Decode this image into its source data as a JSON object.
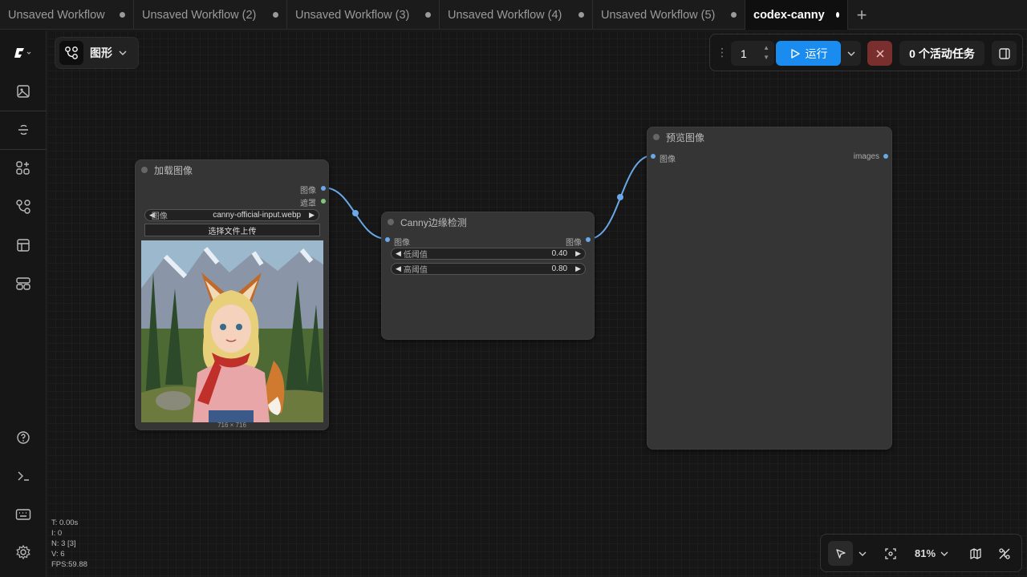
{
  "tabs": [
    {
      "label": "Unsaved Workflow",
      "active": false
    },
    {
      "label": "Unsaved Workflow (2)",
      "active": false
    },
    {
      "label": "Unsaved Workflow (3)",
      "active": false
    },
    {
      "label": "Unsaved Workflow (4)",
      "active": false
    },
    {
      "label": "Unsaved Workflow (5)",
      "active": false
    },
    {
      "label": "codex-canny",
      "active": true
    }
  ],
  "graph_menu": {
    "label": "图形"
  },
  "runbar": {
    "batch_count": "1",
    "run_label": "运行",
    "queue_label": "0 个活动任务"
  },
  "nodes": {
    "load_image": {
      "title": "加载图像",
      "out_image": "图像",
      "out_mask": "遮罩",
      "widget_name": "图像",
      "widget_value": "canny-official-input.webp",
      "upload_label": "选择文件上传",
      "image_size": "716 × 716"
    },
    "canny": {
      "title": "Canny边缘检测",
      "in_image": "图像",
      "out_image": "图像",
      "low_name": "低阈值",
      "low_value": "0.40",
      "high_name": "高阈值",
      "high_value": "0.80"
    },
    "preview": {
      "title": "预览图像",
      "in_image": "图像",
      "out_images": "images"
    }
  },
  "stats": {
    "t": "T: 0.00s",
    "i": "I: 0",
    "n": "N: 3 [3]",
    "v": "V: 6",
    "fps": "FPS:59.88"
  },
  "zoom": {
    "level": "81%"
  },
  "colors": {
    "accent": "#1a8cf0",
    "link": "#6aa8e8",
    "mask_port": "#7fc97f",
    "cancel": "#7a2f2f",
    "node_bg": "#353535"
  },
  "icons": [
    "comfy-logo-icon",
    "images-icon",
    "model-icon",
    "node-library-icon",
    "workflow-icon",
    "templates-icon",
    "queue-icon",
    "help-icon",
    "terminal-icon",
    "keyboard-icon",
    "settings-icon",
    "select-pointer-icon",
    "fit-view-icon",
    "minimap-icon",
    "hide-links-icon"
  ]
}
